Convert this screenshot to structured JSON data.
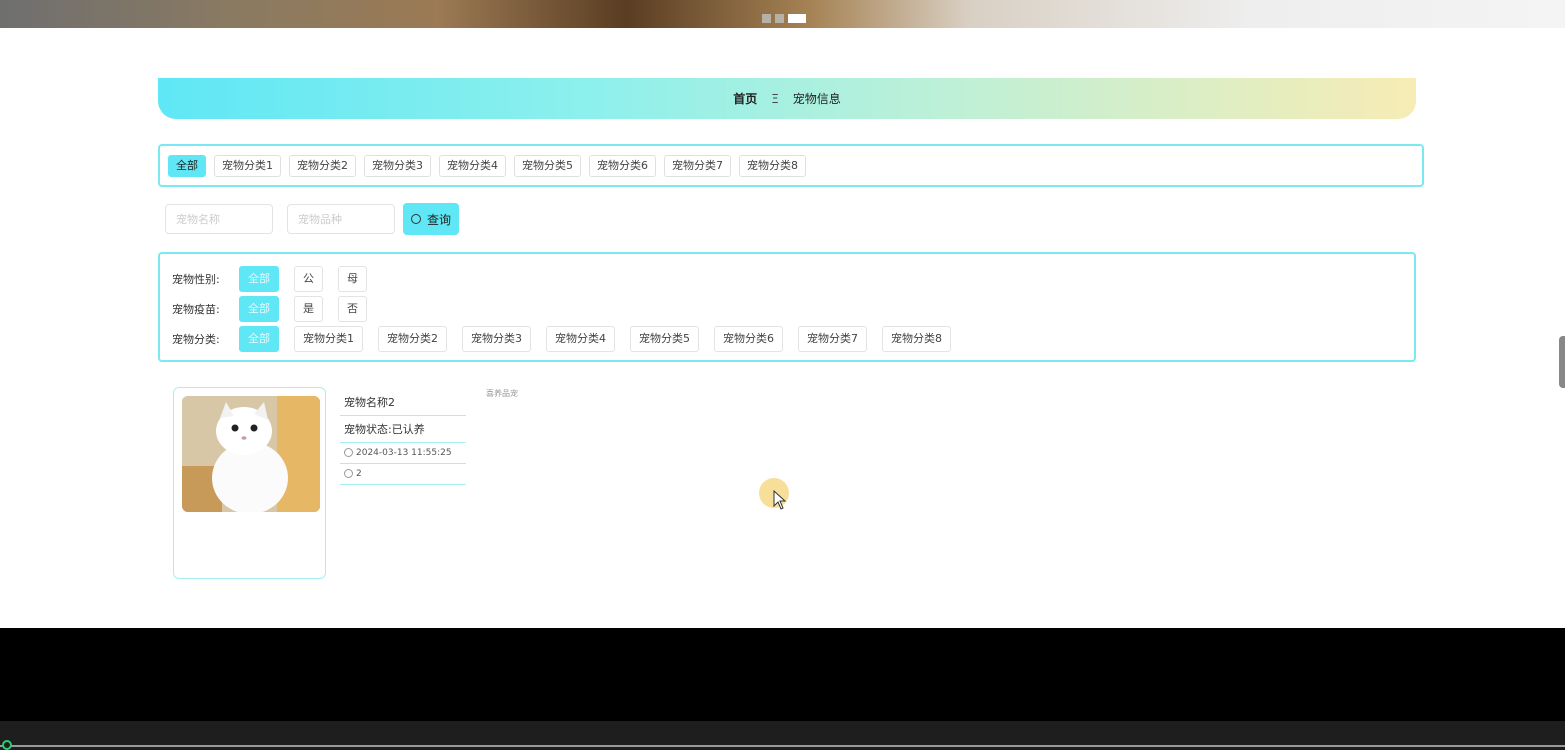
{
  "breadcrumb": {
    "home": "首页",
    "separator": "Ξ",
    "current": "宠物信息"
  },
  "categories": [
    "全部",
    "宠物分类1",
    "宠物分类2",
    "宠物分类3",
    "宠物分类4",
    "宠物分类5",
    "宠物分类6",
    "宠物分类7",
    "宠物分类8"
  ],
  "search": {
    "name_placeholder": "宠物名称",
    "breed_placeholder": "宠物品种",
    "query_label": "查询"
  },
  "filters": {
    "gender": {
      "label": "宠物性别:",
      "options": [
        "全部",
        "公",
        "母"
      ]
    },
    "vaccine": {
      "label": "宠物疫苗:",
      "options": [
        "全部",
        "是",
        "否"
      ]
    },
    "category": {
      "label": "宠物分类:",
      "options": [
        "全部",
        "宠物分类1",
        "宠物分类2",
        "宠物分类3",
        "宠物分类4",
        "宠物分类5",
        "宠物分类6",
        "宠物分类7",
        "宠物分类8"
      ]
    }
  },
  "card": {
    "name": "宠物名称2",
    "status": "宠物状态:已认养",
    "time": "2024-03-13 11:55:25",
    "count": "2"
  },
  "extra_text": "喜养品宠",
  "colors": {
    "accent": "#5fe7f5",
    "border": "#7be9f2"
  },
  "icons": [
    "clock-icon",
    "comment-icon",
    "search-icon"
  ]
}
